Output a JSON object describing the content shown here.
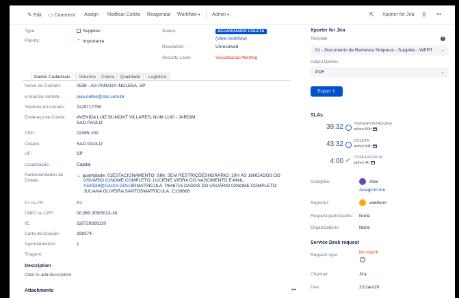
{
  "toolbar": {
    "edit": "Edit",
    "comment": "Comment",
    "assign": "Assign",
    "notificar": "Notificar Coleta",
    "reagendar": "Reagendar",
    "workflow": "Workflow",
    "admin": "Admin",
    "xporter": "Xporter for Jira",
    "more": "•••"
  },
  "details": {
    "type_label": "Type:",
    "type_value": "Supplies",
    "priority_label": "Priority:",
    "priority_value": "Importante",
    "status_label": "Status:",
    "status_value": "AGUARDANDO COLETA",
    "view_workflow": "(View workflow)",
    "resolution_label": "Resolution:",
    "resolution_value": "Unresolved",
    "security_label": "Security Level:",
    "security_value": "Visualizacao Wertlog"
  },
  "tabs": [
    "Dados Cadastrais",
    "Volumes",
    "Coleta",
    "Qualidade",
    "Logistica"
  ],
  "fields": {
    "nome_contato_label": "Nome do Contato:",
    "nome_contato": "0538 - AG PARADA INGLESA, SP",
    "email_label": "e-mail do contato:",
    "email": "jose.nobre@cbs.com.br",
    "telefone_label": "Telefone do contato:",
    "telefone": "1129717750",
    "endereco_label": "Endereço de Coleta:",
    "endereco_line1": "AVENIDA LUIZ DUMONT VILLARES, NUM 1160 - JARDIM",
    "endereco_line2": "SAO PAULO",
    "cep_label": "CEP:",
    "cep": "02085-100",
    "cidade_label": "Cidade:",
    "cidade": "SAO PAULO",
    "uf_label": "UF:",
    "uf": "SP",
    "localizacao_label": "Localização:",
    "localizacao": "Capital",
    "particularidades_label_1": "Particularidades de",
    "particularidades_label_2": "Coleta:",
    "particularidades_line1": "quantidade: 01ESTACIONAMENTO: SIM, SEM RESTRIÇÕESHORÁRIO: 10H ÀS 16HDADOS DO",
    "particularidades_line2": "USUÁRIO 01NOME COMPLETO: LUCIENE VIEIRA DO NASCIMENTO E-MAIL:",
    "particularidades_line3_link": "AG0538@CAIXA.GOV.BR",
    "particularidades_line3_rest": "MATRICULA: P646716 DADOS DO USUÁRIO 02NOME COMPLETO:",
    "particularidades_line4": "JULIANA OLIVEIRA SANTOSMATRÍCULA: C139668",
    "pj_label": "PJ ou PF:",
    "pj": "PJ",
    "cnpj_label": "CNPJ ou CPF:",
    "cnpj": "00.360.305/5013-16",
    "ie_label": "IE:",
    "ie": "116729326110",
    "carta_label": "Carta de Doação:",
    "carta": "199374",
    "agendamentos_label": "Agendamentos:",
    "agendamentos": "1",
    "triagem_label": "Triagem:"
  },
  "description": {
    "title": "Description",
    "placeholder": "Click to add description"
  },
  "attachments": {
    "title": "Attachments",
    "more": "•••"
  },
  "xporter": {
    "title": "Xporter for Jira",
    "template_label": "Template",
    "template_value": "01 - Documento de Remessa Simpress - Supplies - WERT",
    "output_label": "Output Options",
    "output_value": "PDF",
    "export_button": "Export"
  },
  "slas": {
    "title": "SLAs",
    "items": [
      {
        "time": "39:32",
        "name": "TRANSPORTADORA",
        "within": "within 50h"
      },
      {
        "time": "43:32",
        "name": "COLETA",
        "within": "within 54h"
      },
      {
        "time": "4:00",
        "name": "CONFERENCIA",
        "within": "within 4h"
      }
    ]
  },
  "people": {
    "assignee_label": "Assignee:",
    "assignee": "Alex",
    "assign_to_me": "Assign to me",
    "reporter_label": "Reporter:",
    "reporter": "webform",
    "participants_label": "Request participants:",
    "participants": "None",
    "organizations_label": "Organizations:",
    "organizations": "None"
  },
  "service_desk": {
    "title": "Service Desk request",
    "request_type_label": "Request type:",
    "request_type": "No match",
    "channel_label": "Channel:",
    "channel": "Jira",
    "due_label": "Due:",
    "due": "22/Jan/19"
  },
  "colors": {
    "primary": "#0052cc",
    "danger": "#de350b",
    "success": "#36b37e"
  }
}
